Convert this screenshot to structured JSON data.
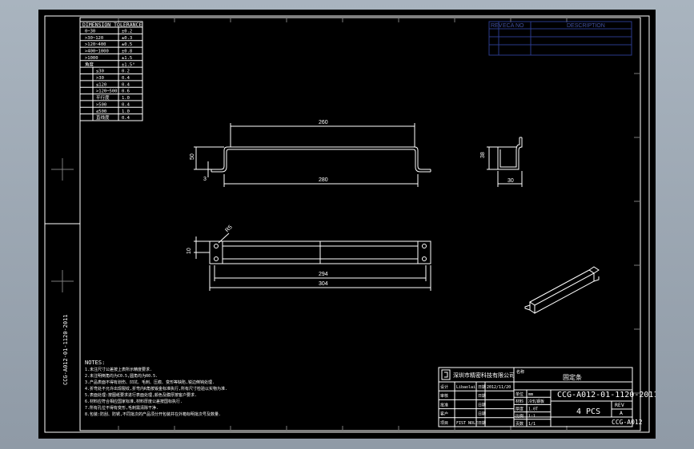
{
  "tolerance_table": {
    "header": "DIMENSION TOLERANCE",
    "rows": [
      [
        "0~30",
        "±0.2"
      ],
      [
        ">30~120",
        "±0.3"
      ],
      [
        ">120~400",
        "±0.5"
      ],
      [
        ">400~1000",
        "±0.8"
      ],
      [
        ">1000",
        "±1.5"
      ],
      [
        "角度",
        "±1.5°"
      ],
      [
        "≤30",
        "0.2"
      ],
      [
        ">30",
        "0.4"
      ],
      [
        "≤120",
        "0.4"
      ],
      [
        ">120~500",
        "0.6"
      ],
      [
        "平行度",
        "1.0"
      ],
      [
        ">500",
        "0.4"
      ],
      [
        "≤500",
        "1.0"
      ],
      [
        "直线度",
        "0.4"
      ]
    ]
  },
  "revision_table": {
    "headers": [
      "REV",
      "ECA NO",
      "DESCRIPTION"
    ]
  },
  "dimensions": {
    "front_top": "260",
    "front_height": "50",
    "front_small": "3",
    "front_bottom": "280",
    "side_height": "38",
    "side_width": "30",
    "top_radius": "R5",
    "top_height": "10",
    "top_inner": "294",
    "top_outer": "304"
  },
  "notes": {
    "title": "NOTES:",
    "lines": [
      "1.未注尺寸公差按上表所示精度要求.",
      "2.未注明倒角均为C0.5,圆角均为R0.5.",
      "3.产品表面不得有划伤、凹坑、毛刺、压痕、变形等缺陷,锐边倒钝处理.",
      "4.折弯处不允许出现裂纹,折弯内R角按钣金标准执行,所有尺寸检验以实物为准.",
      "5.表面处理:按图纸要求进行表面处理,颜色及膜厚按客户要求.",
      "6.材料应符合相应国家标准,材料厚度公差按国标执行.",
      "7.所有孔位不得有变形,毛刺需清除干净.",
      "8.包装:防刮、防锈,不同批次的产品须分开包装并在外箱标明批次号及数量."
    ]
  },
  "side_label": "CCG-A012-01-1120-2011",
  "title_block": {
    "company": "深圳市精密科技有限公司",
    "part_title_label": "名称",
    "part_name": "固定条",
    "drawing_number": "CCG-A012-01-1120-2011",
    "quantity": "4 PCS",
    "rev_label": "REV",
    "rev_value": "A",
    "model_code": "CCG-A012",
    "rows": [
      [
        "设计",
        "Libaolai",
        "日期",
        "2012/11/20"
      ],
      [
        "审核",
        "",
        "日期",
        ""
      ],
      [
        "批准",
        "",
        "日期",
        ""
      ],
      [
        "客户",
        "",
        "日期",
        ""
      ],
      [
        "项目",
        "FIST NOLE",
        "日期",
        ""
      ]
    ],
    "mid_rows": [
      [
        "单位",
        "mm"
      ],
      [
        "材料",
        "冷轧钢板"
      ],
      [
        "厚度",
        "1.0T"
      ],
      [
        "比例",
        "1:1"
      ],
      [
        "页数",
        "1/1"
      ]
    ]
  }
}
